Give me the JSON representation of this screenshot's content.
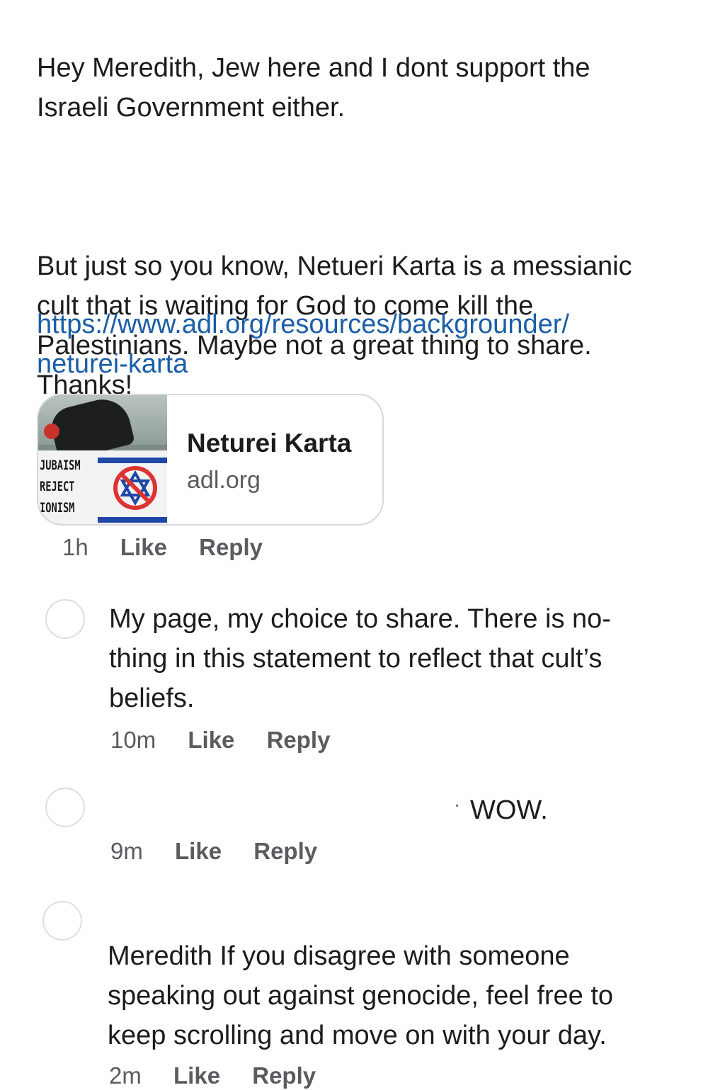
{
  "main_comment": {
    "paragraph_1": "Hey Meredith, Jew here and I dont support the\nIsraeli Government either.",
    "paragraph_2": "But just so you know, Netueri Karta is a messianic\ncult that is waiting for God to come kill the\nPalestinians. Maybe not a great thing to share.\nThanks!",
    "link_text": "https://www.adl.org/resources/backgrounder/\nneturei-karta",
    "link_card": {
      "title": "Neturei Karta",
      "domain": "adl.org",
      "thumbnail_text": [
        "JUBAISM",
        "REJECT",
        "IONISM"
      ]
    },
    "time": "1h",
    "like_label": "Like",
    "reply_label": "Reply"
  },
  "replies": [
    {
      "text": "My page, my choice to share. There is no-\nthing in this statement to reflect that cult’s\nbeliefs.",
      "time": "10m",
      "like_label": "Like",
      "reply_label": "Reply"
    },
    {
      "text": "WOW.",
      "time": "9m",
      "like_label": "Like",
      "reply_label": "Reply"
    },
    {
      "text": "Meredith If you disagree with someone\nspeaking out against genocide, feel free to\nkeep scrolling and move on with your day.",
      "time": "2m",
      "like_label": "Like",
      "reply_label": "Reply"
    }
  ],
  "colors": {
    "text": "#1c1c1e",
    "link": "#1a5ea8",
    "meta": "#5b5b60",
    "border": "#d8d8dc"
  }
}
